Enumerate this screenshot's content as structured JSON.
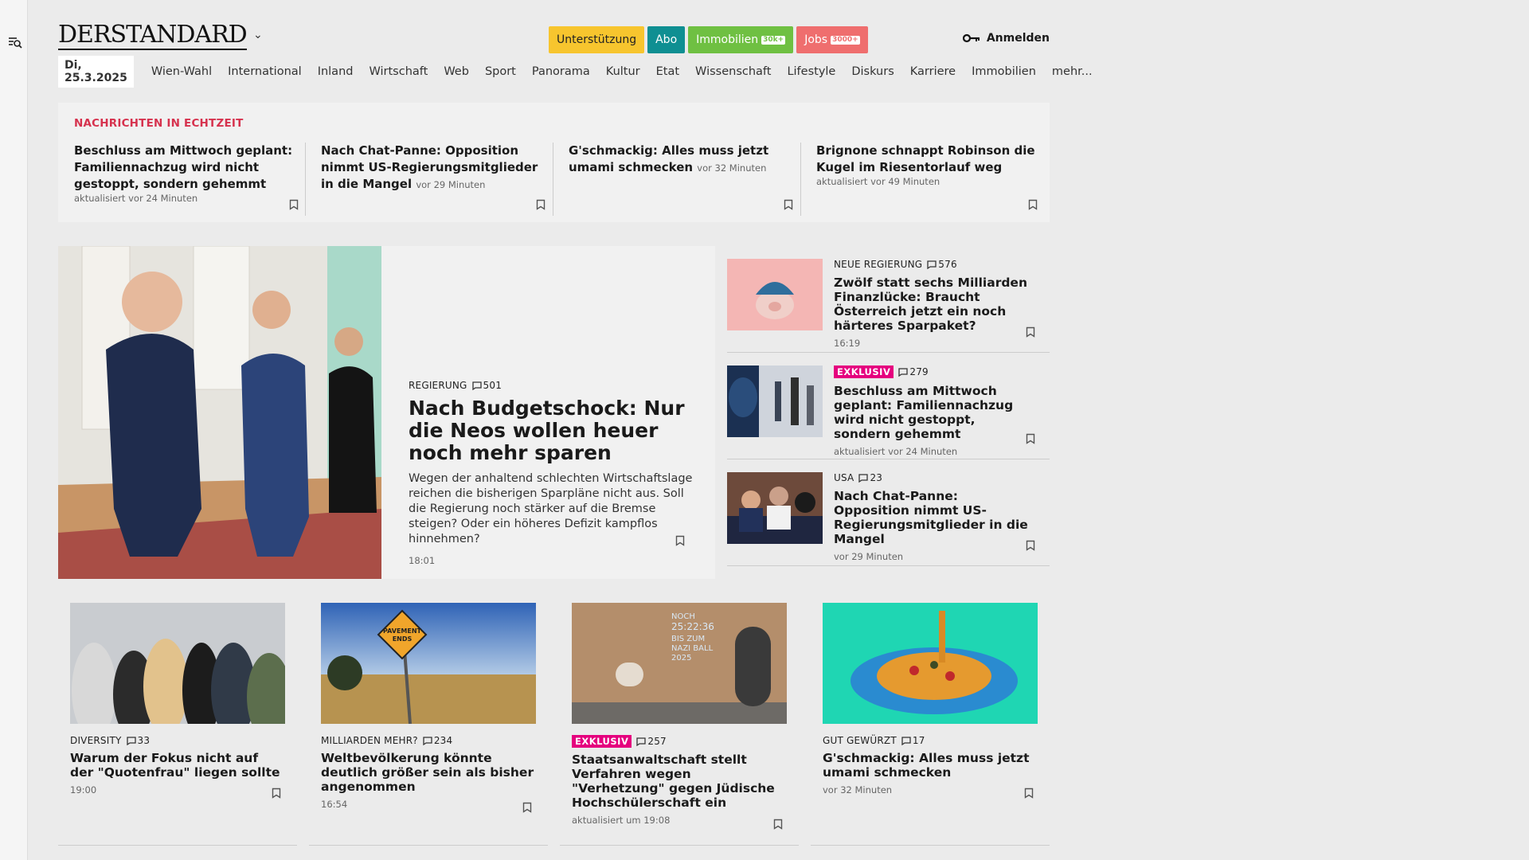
{
  "header": {
    "logo": "DERSTANDARD",
    "pills": {
      "support": "Unterstützung",
      "abo": "Abo",
      "immo": "Immobilien",
      "immo_tag": "30k+",
      "jobs": "Jobs",
      "jobs_tag": "3000+"
    },
    "login": "Anmelden"
  },
  "nav": {
    "date": "Di, 25.3.2025",
    "items": [
      "Wien-Wahl",
      "International",
      "Inland",
      "Wirtschaft",
      "Web",
      "Sport",
      "Panorama",
      "Kultur",
      "Etat",
      "Wissenschaft",
      "Lifestyle",
      "Diskurs",
      "Karriere",
      "Immobilien",
      "mehr..."
    ]
  },
  "ticker": {
    "title": "NACHRICHTEN IN ECHTZEIT",
    "items": [
      {
        "title": "Beschluss am Mittwoch geplant: Familiennachzug wird nicht gestoppt, sondern gehemmt",
        "meta": "aktualisiert vor 24 Minuten"
      },
      {
        "title": "Nach Chat-Panne: Opposition nimmt US-Regierungsmitglieder in die Mangel",
        "meta": "vor 29 Minuten"
      },
      {
        "title": "G'schmackig: Alles muss jetzt umami schmecken",
        "meta": "vor 32 Minuten"
      },
      {
        "title": "Brignone schnappt Robinson die Kugel im Riesentorlauf weg",
        "meta": "aktualisiert vor 49 Minuten"
      }
    ]
  },
  "hero": {
    "kicker": "REGIERUNG",
    "comments": "501",
    "title": "Nach Budgetschock: Nur die Neos wollen heuer noch mehr sparen",
    "teaser": "Wegen der anhaltend schlechten Wirtschaftslage reichen die bisherigen Sparpläne nicht aus. Soll die Regierung noch stärker auf die Bremse steigen? Oder ein höheres Defizit kampflos hinnehmen?",
    "time": "18:01"
  },
  "right": [
    {
      "kicker": "NEUE REGIERUNG",
      "comments": "576",
      "title": "Zwölf statt sechs Milliarden Finanzlücke: Braucht Österreich jetzt ein noch härteres Sparpaket?",
      "meta": "16:19"
    },
    {
      "kicker": "EXKLUSIV",
      "comments": "279",
      "title": "Beschluss am Mittwoch geplant: Familiennachzug wird nicht gestoppt, sondern gehemmt",
      "meta": "aktualisiert vor 24 Minuten"
    },
    {
      "kicker": "USA",
      "comments": "23",
      "title": "Nach Chat-Panne: Opposition nimmt US-Regierungsmitglieder in die Mangel",
      "meta": "vor 29 Minuten"
    }
  ],
  "grid": [
    {
      "kicker": "DIVERSITY",
      "comments": "33",
      "title": "Warum der Fokus nicht auf der \"Quotenfrau\" liegen sollte",
      "meta": "19:00"
    },
    {
      "kicker": "MILLIARDEN MEHR?",
      "comments": "234",
      "title": "Weltbevölkerung könnte deutlich größer sein als bisher angenommen",
      "meta": "16:54"
    },
    {
      "kicker": "EXKLUSIV",
      "comments": "257",
      "title": "Staatsanwaltschaft stellt Verfahren wegen \"Verhetzung\" gegen Jüdische Hochschülerschaft ein",
      "meta": "aktualisiert um 19:08"
    },
    {
      "kicker": "GUT GEWÜRZT",
      "comments": "17",
      "title": "G'schmackig: Alles muss jetzt umami schmecken",
      "meta": "vor 32 Minuten"
    }
  ],
  "images": {
    "sign_text": "PAVEMENT ENDS",
    "wall_text": "NOCH 25:22:36 BIS ZUM NAZI BALL 2025"
  },
  "colors": {
    "ticker_title": "#d6324e",
    "exclusive": "#e5007e",
    "abo": "#0f8f92",
    "support": "#f7c52e",
    "immo": "#6fc042",
    "jobs": "#ef6e6e"
  }
}
